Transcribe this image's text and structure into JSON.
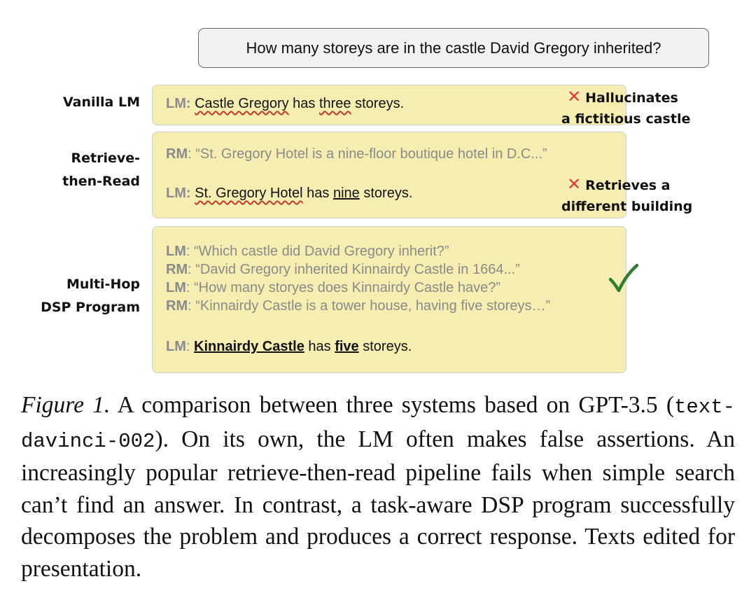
{
  "question": "How many storeys are in the castle David Gregory inherited?",
  "rows": {
    "vanilla": {
      "label": "Vanilla LM",
      "lm_prefix": "LM:",
      "lm_entity": "Castle Gregory",
      "lm_mid": " has ",
      "lm_number": "three",
      "lm_end": " storeys.",
      "verdict_line1": "Hallucinates",
      "verdict_line2": "a fictitious castle"
    },
    "retrieve_then_read": {
      "label_line1": "Retrieve-",
      "label_line2": "then-Read",
      "rm_prefix": "RM",
      "rm_text": ": “St. Gregory Hotel is a nine-floor boutique hotel in D.C...”",
      "lm_prefix": "LM:",
      "lm_entity": "St. Gregory Hotel",
      "lm_mid": " has ",
      "lm_number": "nine",
      "lm_end": " storeys.",
      "verdict_line1": "Retrieves a",
      "verdict_line2": "different building"
    },
    "dsp": {
      "label_line1": "Multi-Hop",
      "label_line2": "DSP Program",
      "steps": [
        {
          "role": "LM",
          "text": ": “Which castle did David Gregory inherit?”"
        },
        {
          "role": "RM",
          "text": ": “David Gregory inherited Kinnairdy Castle in 1664...”"
        },
        {
          "role": "LM",
          "text": ": “How many storyes does Kinnairdy Castle have?”"
        },
        {
          "role": "RM",
          "text": ": “Kinnairdy Castle is a tower house, having five storeys…”"
        }
      ],
      "answer_prefix": "LM",
      "answer_colon": ": ",
      "answer_entity": "Kinnairdy Castle",
      "answer_mid": " has ",
      "answer_number": "five",
      "answer_end": " storeys."
    }
  },
  "caption": {
    "figure_label": "Figure 1.",
    "text_1": " A comparison between three systems based on GPT-3.5 (",
    "code": "text-davinci-002",
    "text_2": "). On its own, the LM often makes false assertions. An increasingly popular retrieve-then-read pipeline fails when simple search can’t find an answer. In contrast, a task-aware DSP program successfully decomposes the problem and produces a correct response. Texts edited for presentation."
  },
  "colors": {
    "panel": "#f5eeb0",
    "cross": "#e53935",
    "check": "#2e7d32",
    "gray_text": "#8a8a8a"
  },
  "icons": {
    "cross": "cross-icon",
    "check": "checkmark-icon"
  }
}
